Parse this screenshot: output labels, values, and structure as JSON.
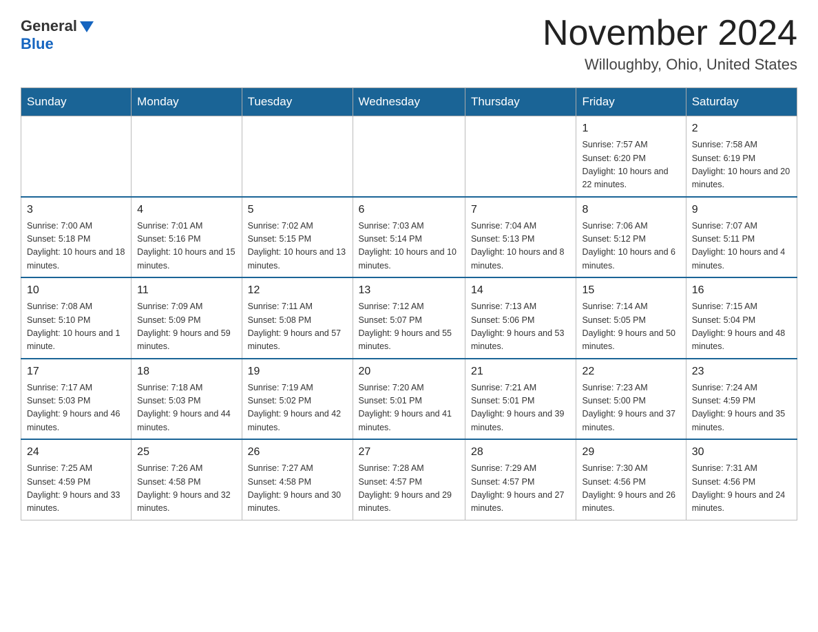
{
  "header": {
    "logo_general": "General",
    "logo_blue": "Blue",
    "title": "November 2024",
    "location": "Willoughby, Ohio, United States"
  },
  "days_of_week": [
    "Sunday",
    "Monday",
    "Tuesday",
    "Wednesday",
    "Thursday",
    "Friday",
    "Saturday"
  ],
  "weeks": [
    [
      {
        "day": "",
        "sunrise": "",
        "sunset": "",
        "daylight": ""
      },
      {
        "day": "",
        "sunrise": "",
        "sunset": "",
        "daylight": ""
      },
      {
        "day": "",
        "sunrise": "",
        "sunset": "",
        "daylight": ""
      },
      {
        "day": "",
        "sunrise": "",
        "sunset": "",
        "daylight": ""
      },
      {
        "day": "",
        "sunrise": "",
        "sunset": "",
        "daylight": ""
      },
      {
        "day": "1",
        "sunrise": "Sunrise: 7:57 AM",
        "sunset": "Sunset: 6:20 PM",
        "daylight": "Daylight: 10 hours and 22 minutes."
      },
      {
        "day": "2",
        "sunrise": "Sunrise: 7:58 AM",
        "sunset": "Sunset: 6:19 PM",
        "daylight": "Daylight: 10 hours and 20 minutes."
      }
    ],
    [
      {
        "day": "3",
        "sunrise": "Sunrise: 7:00 AM",
        "sunset": "Sunset: 5:18 PM",
        "daylight": "Daylight: 10 hours and 18 minutes."
      },
      {
        "day": "4",
        "sunrise": "Sunrise: 7:01 AM",
        "sunset": "Sunset: 5:16 PM",
        "daylight": "Daylight: 10 hours and 15 minutes."
      },
      {
        "day": "5",
        "sunrise": "Sunrise: 7:02 AM",
        "sunset": "Sunset: 5:15 PM",
        "daylight": "Daylight: 10 hours and 13 minutes."
      },
      {
        "day": "6",
        "sunrise": "Sunrise: 7:03 AM",
        "sunset": "Sunset: 5:14 PM",
        "daylight": "Daylight: 10 hours and 10 minutes."
      },
      {
        "day": "7",
        "sunrise": "Sunrise: 7:04 AM",
        "sunset": "Sunset: 5:13 PM",
        "daylight": "Daylight: 10 hours and 8 minutes."
      },
      {
        "day": "8",
        "sunrise": "Sunrise: 7:06 AM",
        "sunset": "Sunset: 5:12 PM",
        "daylight": "Daylight: 10 hours and 6 minutes."
      },
      {
        "day": "9",
        "sunrise": "Sunrise: 7:07 AM",
        "sunset": "Sunset: 5:11 PM",
        "daylight": "Daylight: 10 hours and 4 minutes."
      }
    ],
    [
      {
        "day": "10",
        "sunrise": "Sunrise: 7:08 AM",
        "sunset": "Sunset: 5:10 PM",
        "daylight": "Daylight: 10 hours and 1 minute."
      },
      {
        "day": "11",
        "sunrise": "Sunrise: 7:09 AM",
        "sunset": "Sunset: 5:09 PM",
        "daylight": "Daylight: 9 hours and 59 minutes."
      },
      {
        "day": "12",
        "sunrise": "Sunrise: 7:11 AM",
        "sunset": "Sunset: 5:08 PM",
        "daylight": "Daylight: 9 hours and 57 minutes."
      },
      {
        "day": "13",
        "sunrise": "Sunrise: 7:12 AM",
        "sunset": "Sunset: 5:07 PM",
        "daylight": "Daylight: 9 hours and 55 minutes."
      },
      {
        "day": "14",
        "sunrise": "Sunrise: 7:13 AM",
        "sunset": "Sunset: 5:06 PM",
        "daylight": "Daylight: 9 hours and 53 minutes."
      },
      {
        "day": "15",
        "sunrise": "Sunrise: 7:14 AM",
        "sunset": "Sunset: 5:05 PM",
        "daylight": "Daylight: 9 hours and 50 minutes."
      },
      {
        "day": "16",
        "sunrise": "Sunrise: 7:15 AM",
        "sunset": "Sunset: 5:04 PM",
        "daylight": "Daylight: 9 hours and 48 minutes."
      }
    ],
    [
      {
        "day": "17",
        "sunrise": "Sunrise: 7:17 AM",
        "sunset": "Sunset: 5:03 PM",
        "daylight": "Daylight: 9 hours and 46 minutes."
      },
      {
        "day": "18",
        "sunrise": "Sunrise: 7:18 AM",
        "sunset": "Sunset: 5:03 PM",
        "daylight": "Daylight: 9 hours and 44 minutes."
      },
      {
        "day": "19",
        "sunrise": "Sunrise: 7:19 AM",
        "sunset": "Sunset: 5:02 PM",
        "daylight": "Daylight: 9 hours and 42 minutes."
      },
      {
        "day": "20",
        "sunrise": "Sunrise: 7:20 AM",
        "sunset": "Sunset: 5:01 PM",
        "daylight": "Daylight: 9 hours and 41 minutes."
      },
      {
        "day": "21",
        "sunrise": "Sunrise: 7:21 AM",
        "sunset": "Sunset: 5:01 PM",
        "daylight": "Daylight: 9 hours and 39 minutes."
      },
      {
        "day": "22",
        "sunrise": "Sunrise: 7:23 AM",
        "sunset": "Sunset: 5:00 PM",
        "daylight": "Daylight: 9 hours and 37 minutes."
      },
      {
        "day": "23",
        "sunrise": "Sunrise: 7:24 AM",
        "sunset": "Sunset: 4:59 PM",
        "daylight": "Daylight: 9 hours and 35 minutes."
      }
    ],
    [
      {
        "day": "24",
        "sunrise": "Sunrise: 7:25 AM",
        "sunset": "Sunset: 4:59 PM",
        "daylight": "Daylight: 9 hours and 33 minutes."
      },
      {
        "day": "25",
        "sunrise": "Sunrise: 7:26 AM",
        "sunset": "Sunset: 4:58 PM",
        "daylight": "Daylight: 9 hours and 32 minutes."
      },
      {
        "day": "26",
        "sunrise": "Sunrise: 7:27 AM",
        "sunset": "Sunset: 4:58 PM",
        "daylight": "Daylight: 9 hours and 30 minutes."
      },
      {
        "day": "27",
        "sunrise": "Sunrise: 7:28 AM",
        "sunset": "Sunset: 4:57 PM",
        "daylight": "Daylight: 9 hours and 29 minutes."
      },
      {
        "day": "28",
        "sunrise": "Sunrise: 7:29 AM",
        "sunset": "Sunset: 4:57 PM",
        "daylight": "Daylight: 9 hours and 27 minutes."
      },
      {
        "day": "29",
        "sunrise": "Sunrise: 7:30 AM",
        "sunset": "Sunset: 4:56 PM",
        "daylight": "Daylight: 9 hours and 26 minutes."
      },
      {
        "day": "30",
        "sunrise": "Sunrise: 7:31 AM",
        "sunset": "Sunset: 4:56 PM",
        "daylight": "Daylight: 9 hours and 24 minutes."
      }
    ]
  ]
}
